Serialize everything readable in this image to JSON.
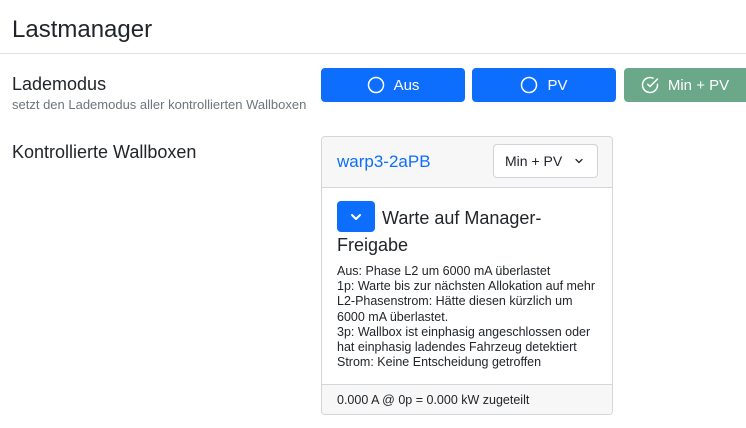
{
  "page": {
    "title": "Lastmanager"
  },
  "charge_mode": {
    "label": "Lademodus",
    "description": "setzt den Lademodus aller kontrollierten Wallboxen",
    "options": [
      {
        "label": "Aus",
        "icon": "circle-icon",
        "selected": false
      },
      {
        "label": "PV",
        "icon": "circle-icon",
        "selected": false
      },
      {
        "label": "Min + PV",
        "icon": "check-circle-icon",
        "selected": true
      }
    ]
  },
  "wallboxes": {
    "label": "Kontrollierte Wallboxen",
    "items": [
      {
        "name": "warp3-2aPB",
        "mode_select": "Min + PV",
        "status_title": "Warte auf Manager-Freigabe",
        "details": [
          "Aus: Phase L2 um 6000 mA überlastet",
          "1p: Warte bis zur nächsten Allokation auf mehr L2-Phasenstrom: Hätte diesen kürzlich um 6000 mA überlastet.",
          "3p: Wallbox ist einphasig angeschlossen oder hat einphasig ladendes Fahrzeug detektiert",
          "Strom: Keine Entscheidung getroffen"
        ],
        "allocation": "0.000 A @ 0p = 0.000 kW zugeteilt"
      }
    ]
  },
  "colors": {
    "primary": "#0d6efd",
    "success": "#6aa889",
    "text": "#212529",
    "muted": "#6c757d"
  }
}
